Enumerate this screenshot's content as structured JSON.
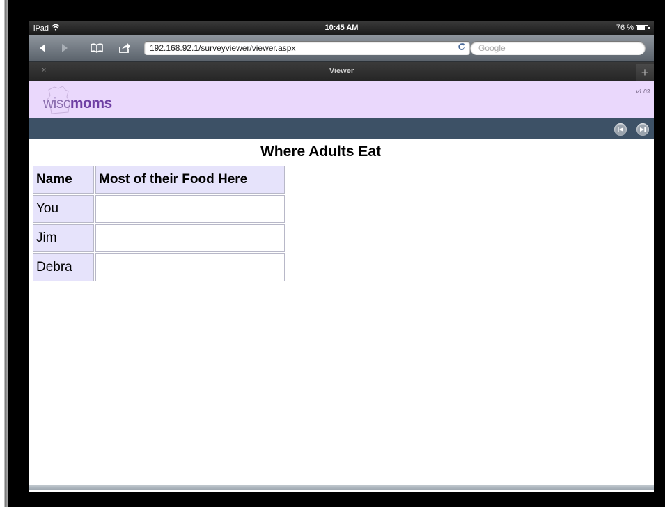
{
  "status_bar": {
    "device": "iPad",
    "time": "10:45 AM",
    "battery": "76 %"
  },
  "toolbar": {
    "url": "192.168.92.1/surveyviewer/viewer.aspx",
    "search_placeholder": "Google"
  },
  "tab": {
    "close": "×",
    "title": "Viewer",
    "add": "+"
  },
  "site": {
    "logo_wisc": "wisc",
    "logo_moms": "moms",
    "version": "v1.03"
  },
  "page": {
    "title": "Where Adults Eat",
    "table": {
      "headers": [
        "Name",
        "Most of their Food Here"
      ],
      "rows": [
        [
          "You",
          ""
        ],
        [
          "Jim",
          ""
        ],
        [
          "Debra",
          ""
        ]
      ]
    }
  },
  "colors": {
    "header_bg": "#ead8fc",
    "nav_strip": "#3d5166",
    "table_cell_bg": "#e6e3fb"
  }
}
